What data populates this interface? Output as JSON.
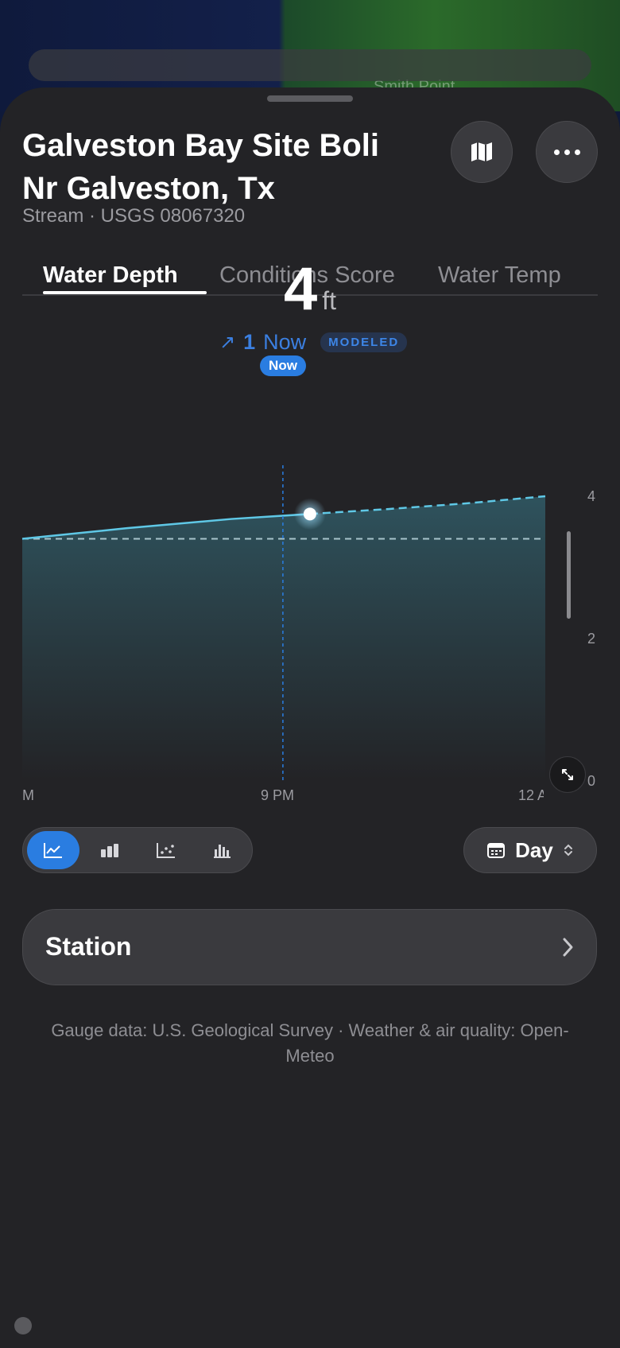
{
  "background": {
    "map_label": "Smith Point"
  },
  "header": {
    "title": "Galveston Bay Site Boli Nr Galveston, Tx",
    "subtitle": "Stream · USGS 08067320",
    "map_icon": "map-icon",
    "more_icon": "ellipsis-icon"
  },
  "tabs": [
    {
      "label": "Water Depth",
      "active": true
    },
    {
      "label": "Conditions Score",
      "active": false
    },
    {
      "label": "Water Temp",
      "active": false
    }
  ],
  "reading": {
    "value": "4",
    "unit": "ft",
    "trend_arrow": "↗",
    "trend_value": "1",
    "trend_label": "Now",
    "badge": "MODELED",
    "now_marker": "Now"
  },
  "chart_data": {
    "type": "area",
    "x_tick_labels": [
      "M",
      "9 PM",
      "12 A"
    ],
    "y_tick_labels": [
      "4",
      "2",
      "0"
    ],
    "ylim": [
      0,
      4
    ],
    "series": [
      {
        "x": [
          0,
          0.2,
          0.4,
          0.55,
          0.7,
          0.85,
          1.0
        ],
        "values": [
          3.4,
          3.55,
          3.68,
          3.75,
          3.82,
          3.9,
          4.0
        ]
      }
    ],
    "reference_line": 3.4,
    "current_marker_index": 3,
    "colors": {
      "line": "#5fc8e6",
      "fill": "#2f5560",
      "marker": "#ffffff",
      "now_line": "#2a7de1"
    }
  },
  "controls": {
    "chart_types": [
      {
        "name": "line-chart-icon",
        "active": true
      },
      {
        "name": "bar-chart-icon",
        "active": false
      },
      {
        "name": "scatter-chart-icon",
        "active": false
      },
      {
        "name": "histogram-icon",
        "active": false
      }
    ],
    "period_icon": "calendar-icon",
    "period_label": "Day",
    "period_chevron": "up-down-chevron-icon"
  },
  "station": {
    "label": "Station",
    "chevron": "chevron-right-icon"
  },
  "footer": {
    "attribution": "Gauge data: U.S. Geological Survey · Weather & air quality: Open-Meteo"
  },
  "colors": {
    "accent": "#2a7de1",
    "sheet": "#232326"
  }
}
